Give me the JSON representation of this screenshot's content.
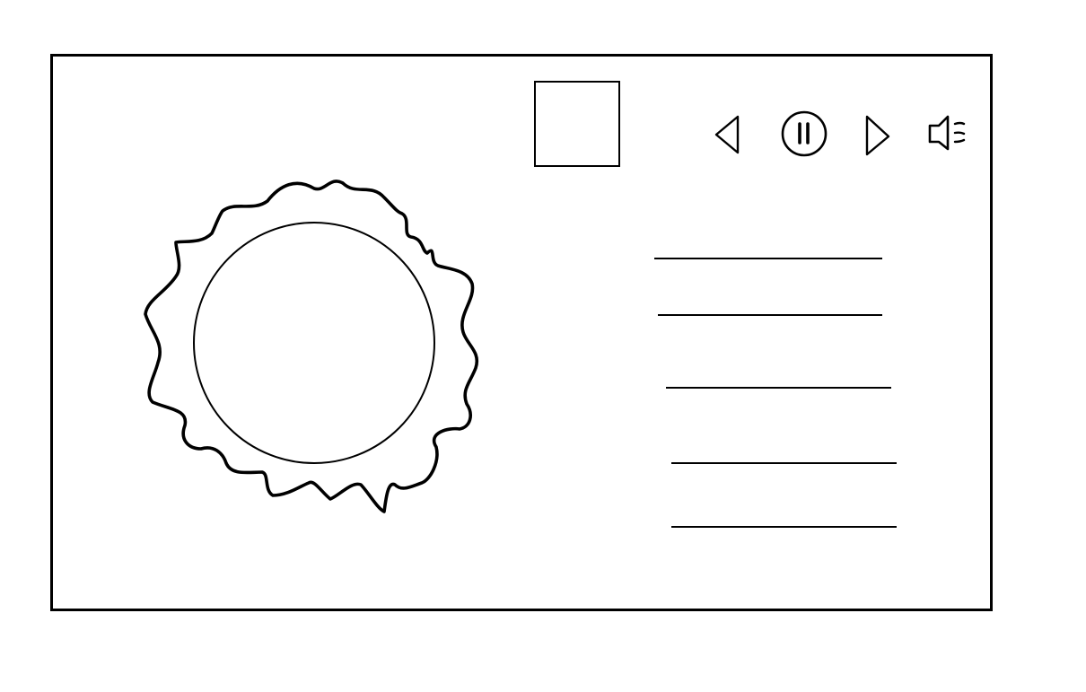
{
  "player": {
    "controls": [
      {
        "id": "prev",
        "icon": "previous-icon"
      },
      {
        "id": "pause",
        "icon": "pause-icon"
      },
      {
        "id": "next",
        "icon": "next-icon"
      },
      {
        "id": "volume",
        "icon": "volume-icon"
      }
    ],
    "album_art": {
      "icon": "album-art-placeholder"
    },
    "visualizer": {
      "icon": "sun-visualizer-icon"
    },
    "playlist": {
      "items": [
        {
          "label": ""
        },
        {
          "label": ""
        },
        {
          "label": ""
        },
        {
          "label": ""
        },
        {
          "label": ""
        }
      ]
    }
  },
  "colors": {
    "stroke": "#000000",
    "background": "#ffffff"
  }
}
